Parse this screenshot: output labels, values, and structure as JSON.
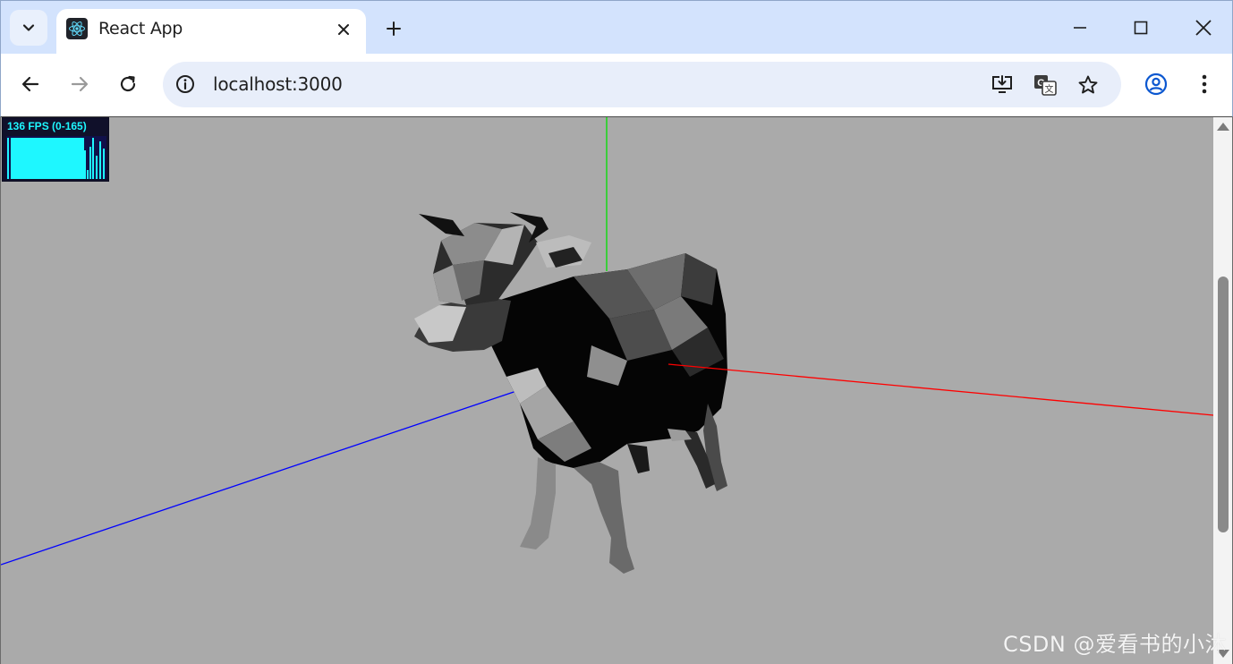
{
  "browser": {
    "tab": {
      "title": "React App",
      "favicon": "react-logo-icon"
    },
    "address_bar": {
      "url": "localhost:3000"
    },
    "icons": {
      "tab_search": "chevron-down-icon",
      "close_tab": "close-icon",
      "new_tab": "plus-icon",
      "minimize": "minimize-icon",
      "maximize": "maximize-icon",
      "close_window": "close-icon",
      "back": "arrow-left-icon",
      "forward": "arrow-right-icon",
      "reload": "reload-icon",
      "site_info": "info-icon",
      "install_app": "install-app-icon",
      "translate": "translate-icon",
      "bookmark": "star-icon",
      "profile": "profile-icon",
      "menu": "more-vert-icon"
    }
  },
  "page": {
    "stats_panel": {
      "label": "136 FPS (0-165)"
    },
    "scene": {
      "background": "#aaaaaa",
      "axes_colors": {
        "x": "#ff0000",
        "y": "#00ff00",
        "z": "#0000ff"
      },
      "object": "low-poly cow model"
    },
    "watermark": "CSDN @爱看书的小沐"
  }
}
